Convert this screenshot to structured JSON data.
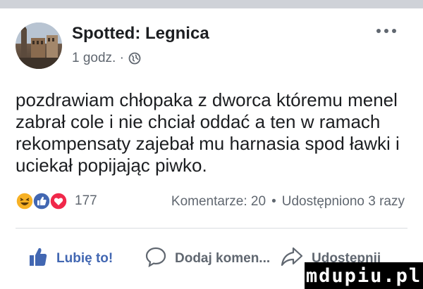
{
  "post": {
    "page_name": "Spotted: Legnica",
    "time": "1 godz. ·",
    "text_lines": [
      "pozdrawiam chłopaka z dworca któremu menel",
      "zabrał cole i nie chciał oddać a ten w ramach",
      "rekompensaty zajebał mu harnasia spod ławki i",
      "uciekał popijając piwko."
    ]
  },
  "reactions": {
    "icons": [
      "haha",
      "like",
      "love"
    ],
    "count": "177"
  },
  "stats": {
    "comments": "Komentarze: 20",
    "separator": "•",
    "shares": "Udostępniono 3 razy"
  },
  "actions": {
    "like": "Lubię to!",
    "comment": "Dodaj komen...",
    "share": "Udostępnij"
  },
  "icons": {
    "privacy": "globe-icon",
    "more": "more-options-icon",
    "like": "thumbs-up-icon",
    "comment": "comment-bubble-icon",
    "share": "share-arrow-icon"
  },
  "colors": {
    "like_blue": "#4267b2",
    "love_red": "#f0284a",
    "haha_yellow": "#f7b125",
    "muted": "#606770"
  },
  "watermark": "mdupiu.pl"
}
